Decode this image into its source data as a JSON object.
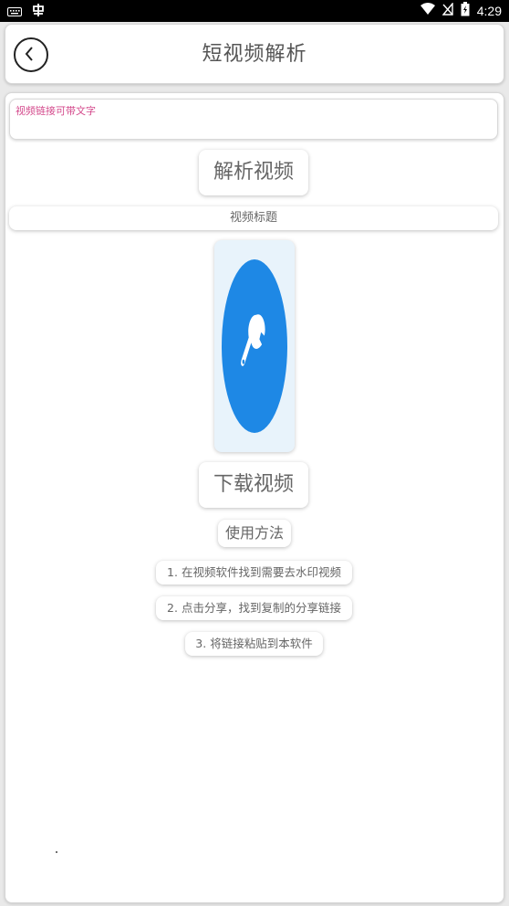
{
  "status_bar": {
    "time": "4:29",
    "icons": [
      "keyboard-icon",
      "bug-icon",
      "wifi-icon",
      "no-signal-icon",
      "battery-icon"
    ]
  },
  "header": {
    "title": "短视频解析",
    "back_icon": "chevron-left-icon"
  },
  "form": {
    "url_placeholder": "视频链接可带文字",
    "url_value": "",
    "parse_button": "解析视频",
    "video_title": "视频标题",
    "thumbnail_icon": "wrench-icon",
    "download_button": "下载视频"
  },
  "usage": {
    "label": "使用方法",
    "steps": [
      "1. 在视频软件找到需要去水印视频",
      "2. 点击分享，找到复制的分享链接",
      "3. 将链接粘贴到本软件"
    ]
  },
  "colors": {
    "accent_blue": "#1e88e5",
    "placeholder_pink": "#d44a8c",
    "thumb_bg": "#e8f3fb"
  }
}
